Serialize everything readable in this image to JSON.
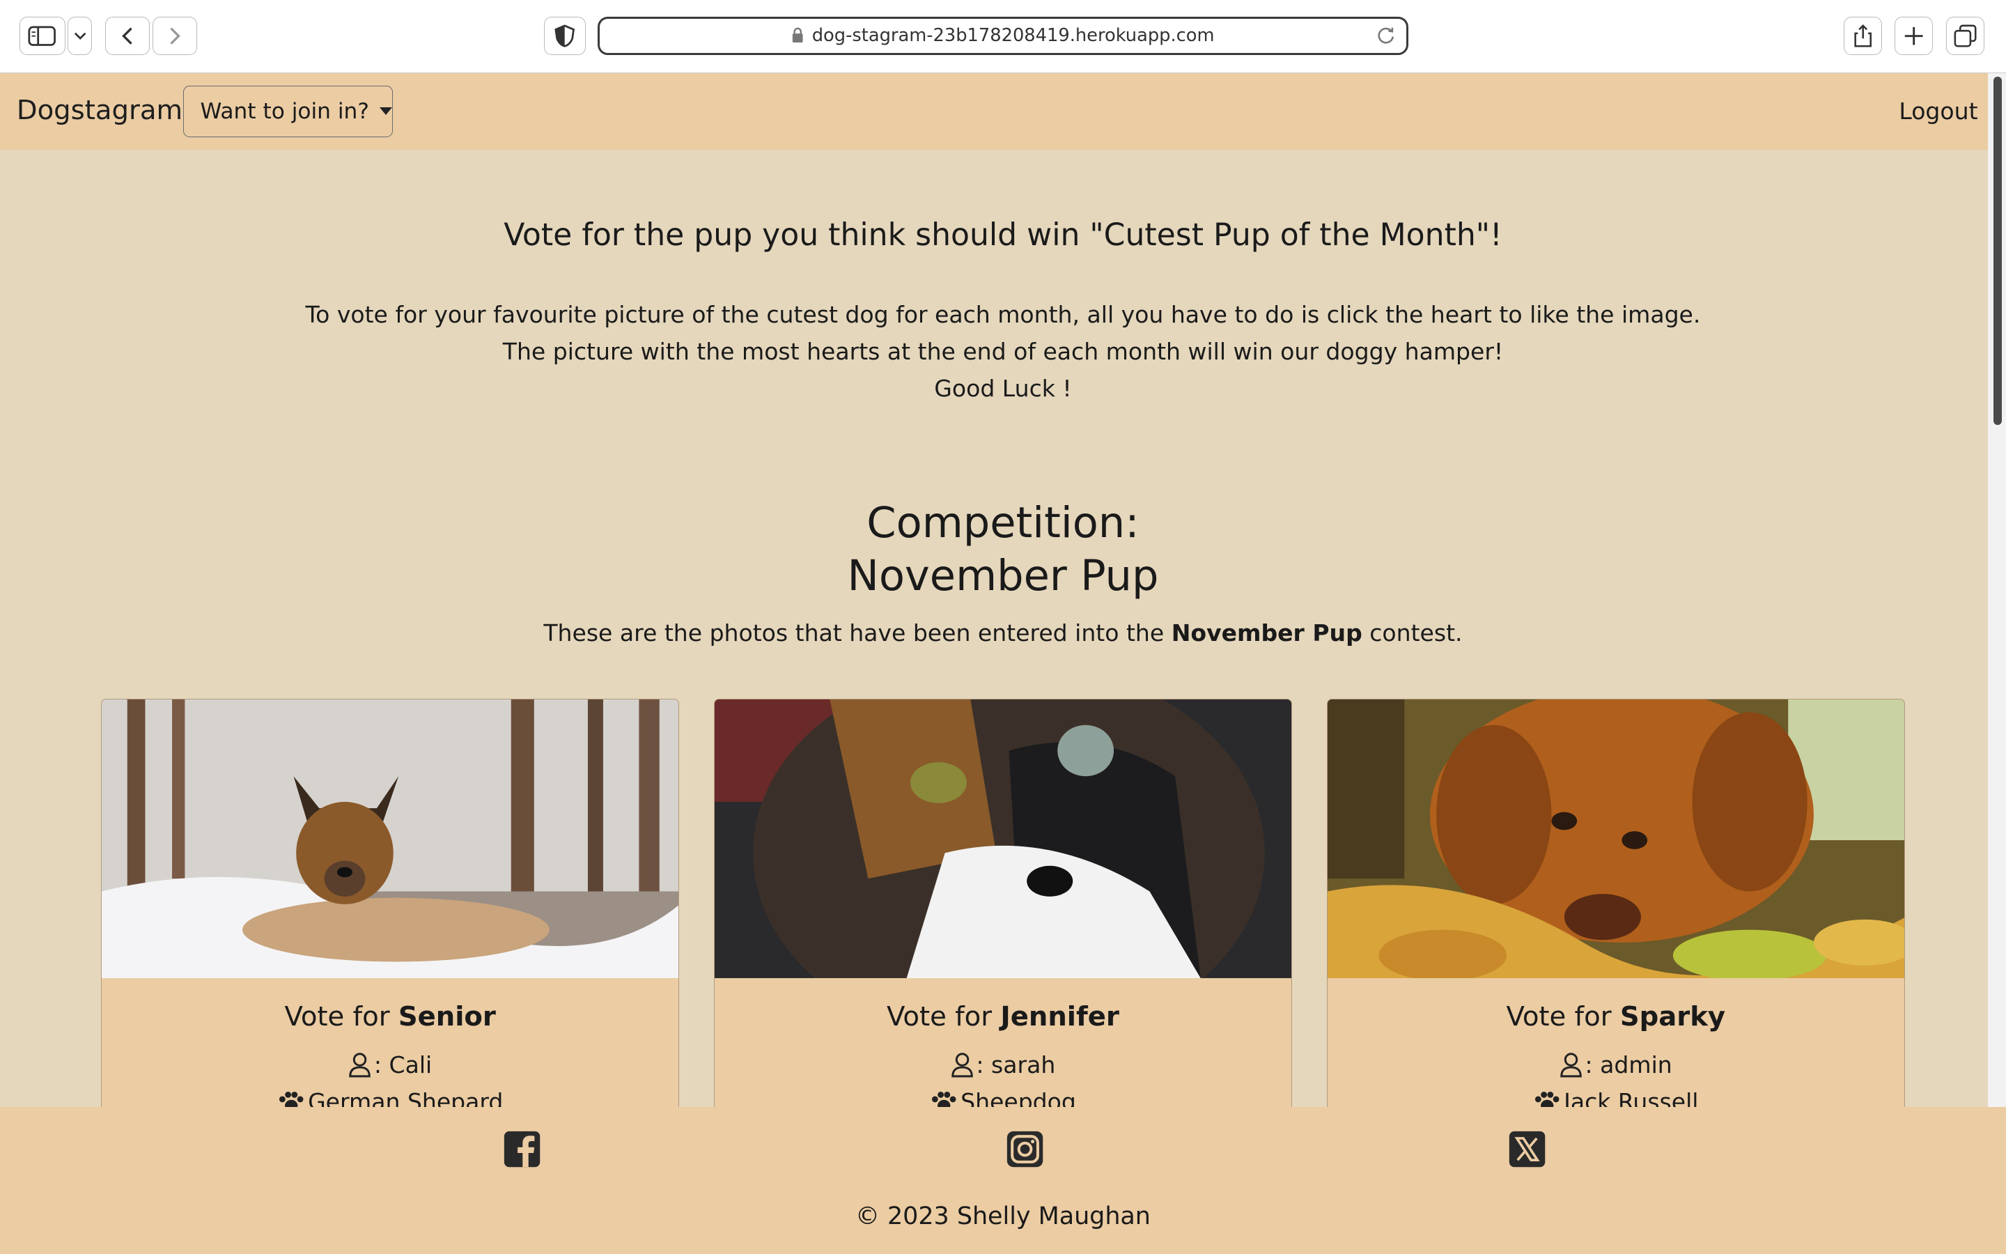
{
  "browser": {
    "url": "dog-stagram-23b178208419.herokuapp.com"
  },
  "navbar": {
    "brand": "Dogstagram",
    "dropdown_label": "Want to join in?",
    "logout_label": "Logout"
  },
  "intro": {
    "heading": "Vote for the pup you think should win \"Cutest Pup of the Month\"!",
    "line1": "To vote for your favourite picture of the cutest dog for each month, all you have to do is click the heart to like the image.",
    "line2": "The picture with the most hearts at the end of each month will win our doggy hamper!",
    "line3": "Good Luck !"
  },
  "competition": {
    "heading_line1": "Competition:",
    "heading_line2": "November Pup",
    "entered_prefix": "These are the photos that have been entered into the ",
    "entered_bold": "November Pup",
    "entered_suffix": " contest."
  },
  "cards": [
    {
      "vote_prefix": "Vote for ",
      "name": "Senior",
      "owner": ": Cali",
      "breed": "German Shepard",
      "image": "german-shepherd-in-snow"
    },
    {
      "vote_prefix": "Vote for ",
      "name": "Jennifer",
      "owner": ": sarah",
      "breed": "Sheepdog",
      "image": "calico-cat-closeup"
    },
    {
      "vote_prefix": "Vote for ",
      "name": "Sparky",
      "owner": ": admin",
      "breed": "Jack Russell",
      "image": "retriever-in-autumn-leaves"
    }
  ],
  "footer": {
    "copyright": "© 2023 Shelly Maughan",
    "social": [
      "facebook-icon",
      "instagram-icon",
      "x-icon"
    ]
  },
  "colors": {
    "page_bg": "#e5d7bc",
    "nav_bg": "#ebcca3",
    "footer_bg": "#ebcca3"
  }
}
